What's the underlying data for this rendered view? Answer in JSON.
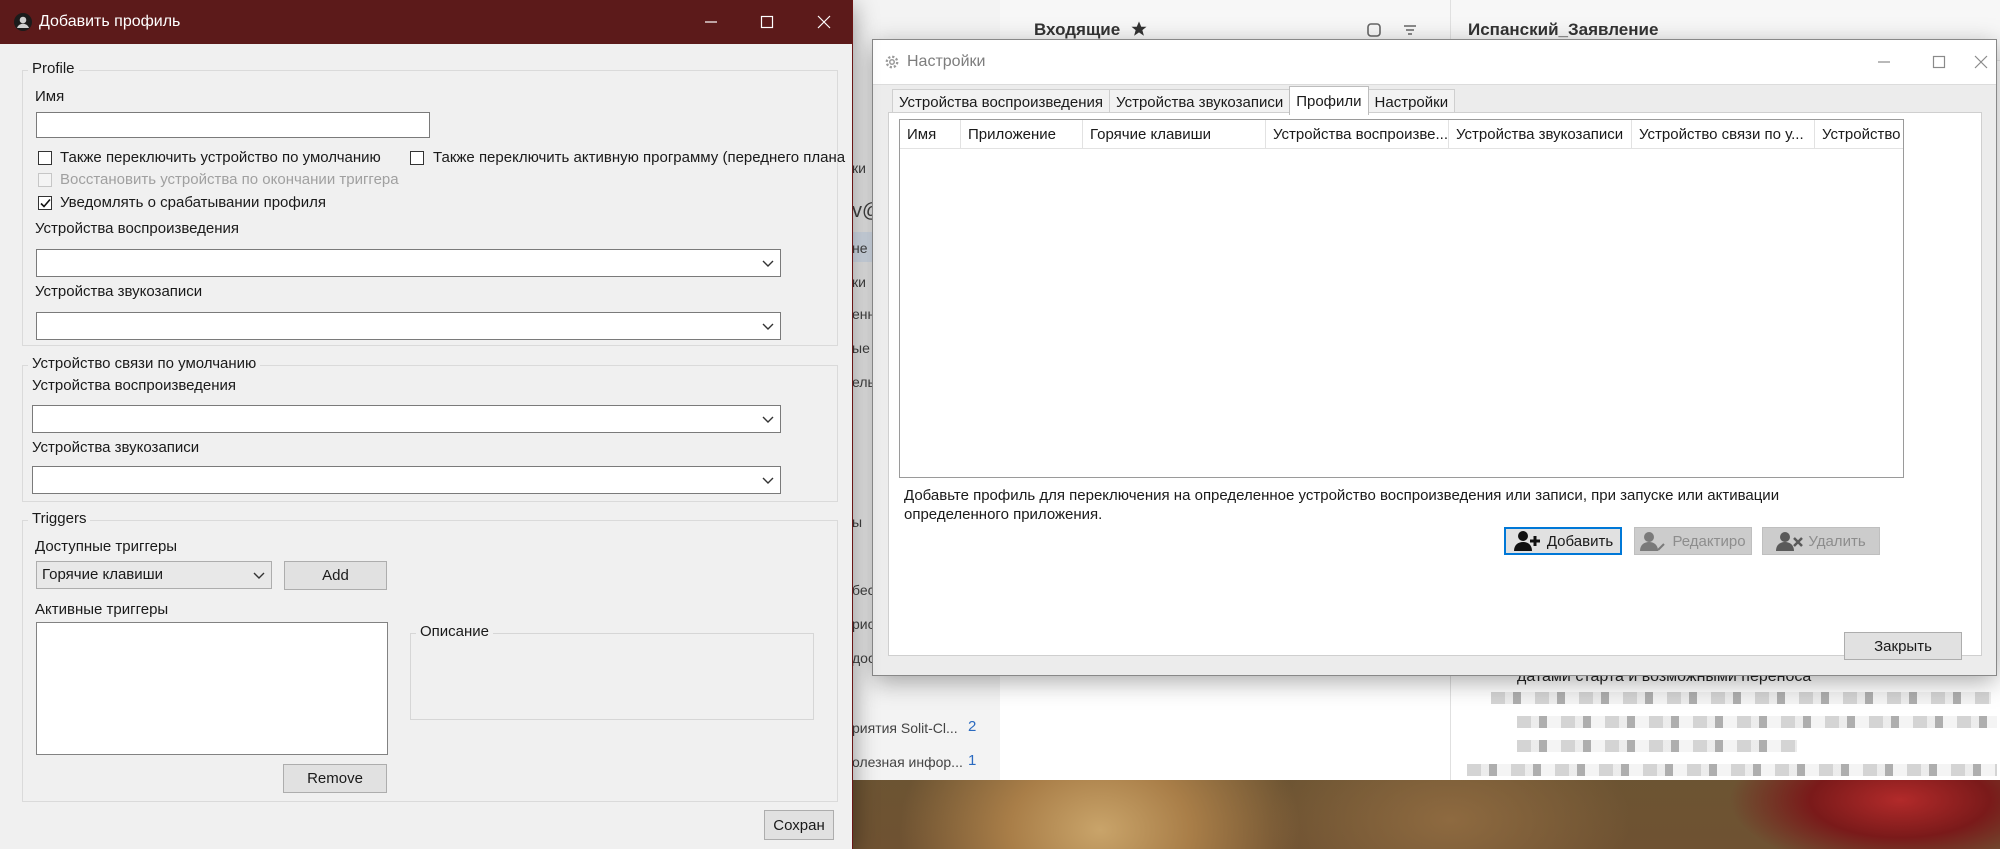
{
  "background_mail": {
    "inbox_title": "Входящие",
    "message_title": "Испанский_Заявление",
    "preview_text": "датами старта и возможными переноса",
    "left_nav": [
      {
        "text": "ки"
      },
      {
        "text": "v@"
      },
      {
        "text": "не"
      },
      {
        "text": "ки"
      },
      {
        "text": "енн"
      },
      {
        "text": "ые"
      },
      {
        "text": "ель"
      },
      {
        "text": "ы"
      },
      {
        "text": "бес"
      },
      {
        "text": "рис"
      },
      {
        "text": "дос"
      }
    ],
    "folders": [
      {
        "label": "риятия Solit-Cl...",
        "count": "2"
      },
      {
        "label": "олезная инфор...",
        "count": "1"
      }
    ]
  },
  "settings_window": {
    "title": "Настройки",
    "tabs": [
      {
        "label": "Устройства воспроизведения"
      },
      {
        "label": "Устройства звукозаписи"
      },
      {
        "label": "Профили"
      },
      {
        "label": "Настройки"
      }
    ],
    "active_tab": "Профили",
    "table_headers": [
      {
        "label": "Имя"
      },
      {
        "label": "Приложение"
      },
      {
        "label": "Горячие клавиши"
      },
      {
        "label": "Устройства воспроизве..."
      },
      {
        "label": "Устройства звукозаписи"
      },
      {
        "label": "Устройство связи по у..."
      },
      {
        "label": "Устройство"
      }
    ],
    "hint_line1": "Добавьте профиль для переключения на определенное устройство воспроизведения или записи, при запуске или активации",
    "hint_line2": "определенного приложения.",
    "add_button": "Добавить",
    "edit_button": "Редактиро",
    "delete_button": "Удалить",
    "close_button": "Закрыть"
  },
  "add_profile_window": {
    "title": "Добавить профиль",
    "profile_group": "Profile",
    "name_label": "Имя",
    "name_value": "",
    "switch_default_label": "Также переключить устройство по умолчанию",
    "switch_default_checked": false,
    "switch_foreground_label": "Также переключить активную программу (переднего плана",
    "switch_foreground_checked": false,
    "restore_label": "Восстановить устройства по окончании триггера",
    "restore_checked": false,
    "notify_label": "Уведомлять о срабатывании профиля",
    "notify_checked": true,
    "playback_label": "Устройства воспроизведения",
    "playback_value": "",
    "recording_label": "Устройства звукозаписи",
    "recording_value": "",
    "comm_group": "Устройство связи по умолчанию",
    "comm_playback_label": "Устройства воспроизведения",
    "comm_playback_value": "",
    "comm_recording_label": "Устройства звукозаписи",
    "comm_recording_value": "",
    "triggers_group": "Triggers",
    "available_triggers_label": "Доступные триггеры",
    "trigger_selected": "Горячие клавиши",
    "add_button": "Add",
    "active_triggers_label": "Активные триггеры",
    "description_group": "Описание",
    "remove_button": "Remove",
    "save_button": "Сохран"
  }
}
